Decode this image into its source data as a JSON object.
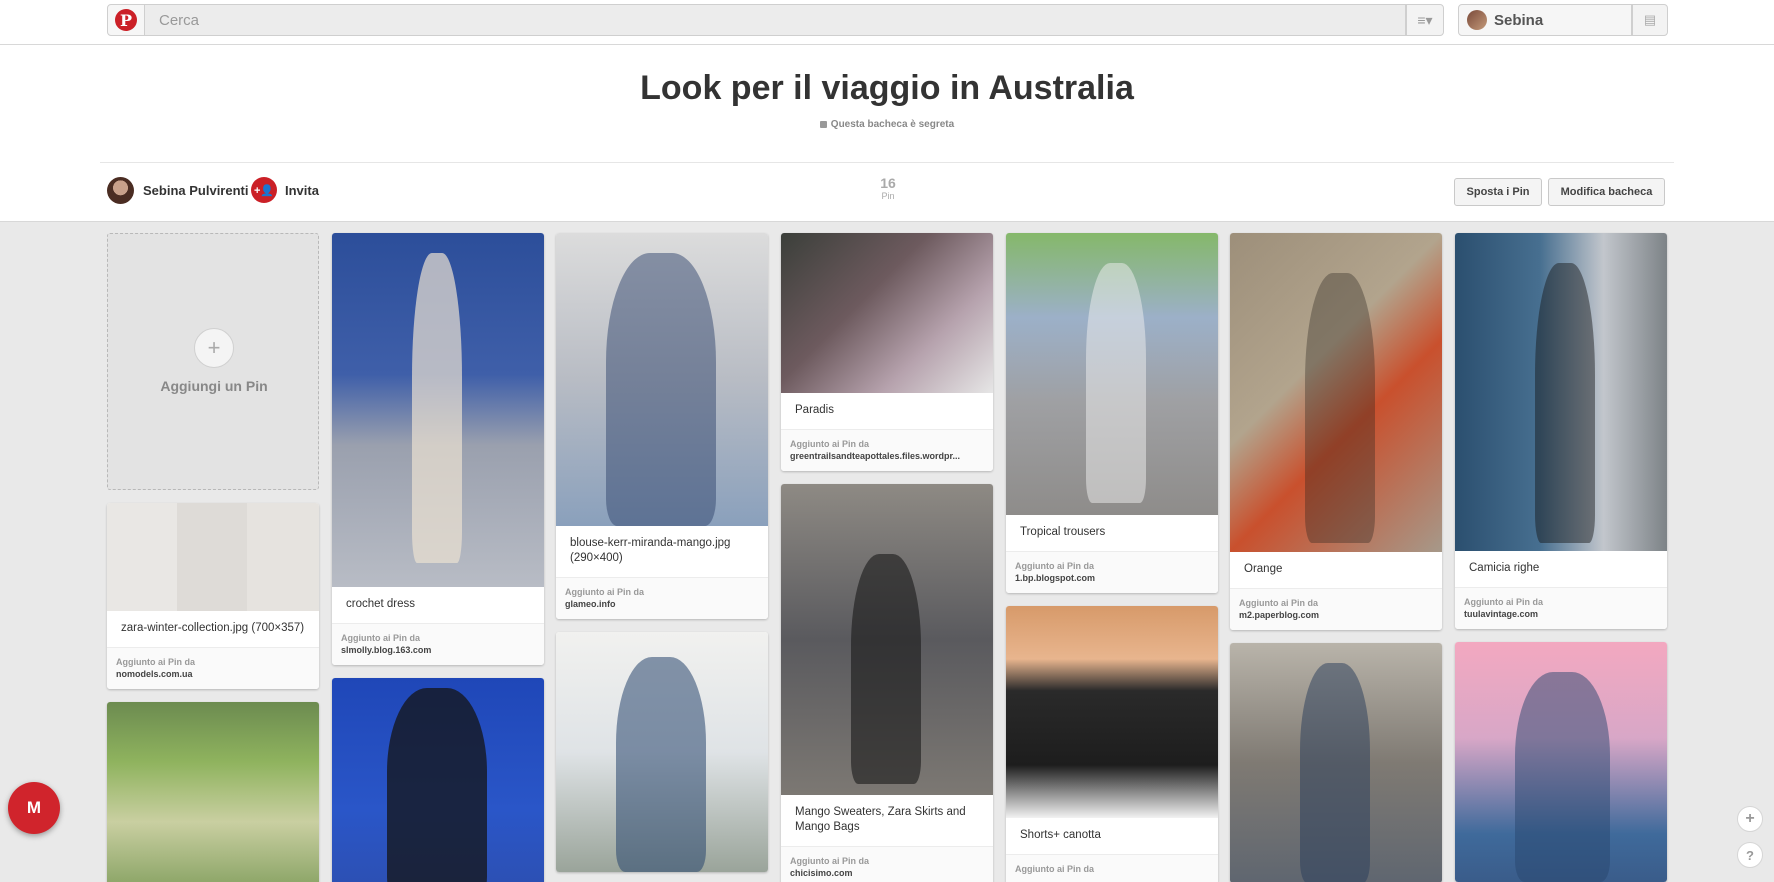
{
  "header": {
    "search_placeholder": "Cerca",
    "logo_letter": "P",
    "menu_icon": "≡▾",
    "user_name": "Sebina",
    "notif_icon": "▤"
  },
  "board": {
    "title": "Look per il viaggio in Australia",
    "secret_label": "Questa bacheca è segreta",
    "owner_name": "Sebina Pulvirenti",
    "invite_label": "Invita",
    "invite_icon": "+👤",
    "pin_count": "16",
    "pin_count_label": "Pin",
    "move_pins_label": "Sposta i Pin",
    "edit_board_label": "Modifica bacheca"
  },
  "add_pin": {
    "label": "Aggiungi un Pin",
    "icon": "+"
  },
  "pins": {
    "zara": {
      "desc": "zara-winter-collection.jpg (700×357)",
      "via": "Aggiunto ai Pin da",
      "site": "nomodels.com.ua"
    },
    "crochet": {
      "desc": "crochet dress",
      "via": "Aggiunto ai Pin da",
      "site": "slmolly.blog.163.com"
    },
    "blouse": {
      "desc": "blouse-kerr-miranda-mango.jpg (290×400)",
      "via": "Aggiunto ai Pin da",
      "site": "glameo.info"
    },
    "paradis": {
      "desc": "Paradis",
      "via": "Aggiunto ai Pin da",
      "site": "greentrailsandteapottales.files.wordpr..."
    },
    "mango": {
      "desc": "Mango Sweaters, Zara Skirts and Mango Bags",
      "via": "Aggiunto ai Pin da",
      "site": "chicisimo.com"
    },
    "tropical": {
      "desc": "Tropical trousers",
      "via": "Aggiunto ai Pin da",
      "site": "1.bp.blogspot.com"
    },
    "shorts": {
      "desc": "Shorts+ canotta",
      "via": "Aggiunto ai Pin da",
      "site": ""
    },
    "orange": {
      "desc": "Orange",
      "via": "Aggiunto ai Pin da",
      "site": "m2.paperblog.com"
    },
    "camicia": {
      "desc": "Camicia righe",
      "via": "Aggiunto ai Pin da",
      "site": "tuulavintage.com"
    }
  },
  "float": {
    "gmail_letter": "M",
    "add_icon": "+",
    "help_icon": "?"
  }
}
